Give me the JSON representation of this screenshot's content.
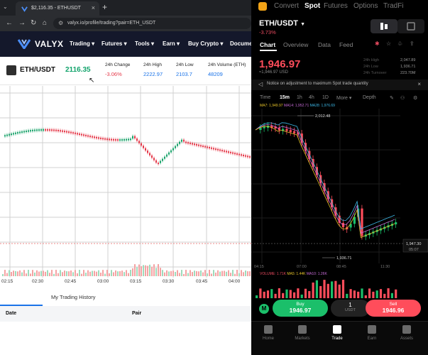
{
  "browser": {
    "tab_title": "$2,116.35 - ETHUSDT",
    "url": "valyx.io/profile/trading?pair=ETH_USDT"
  },
  "site": {
    "logo": "VALYX",
    "nav": [
      "Trading",
      "Futures",
      "Tools",
      "Earn",
      "Buy Crypto",
      "Docume"
    ]
  },
  "ticker": {
    "pair": "ETH/USDT",
    "price": "2116.35",
    "stats": [
      {
        "label": "24h Change",
        "value": "-3.06%",
        "color": "#e5394a"
      },
      {
        "label": "24h High",
        "value": "2222.97",
        "color": "#1a73e8"
      },
      {
        "label": "24h Low",
        "value": "2103.7",
        "color": "#1a73e8"
      },
      {
        "label": "24h Volume (ETH)",
        "value": "48209",
        "color": "#1a73e8"
      }
    ]
  },
  "left_chart": {
    "x_ticks": [
      "02:15",
      "02:30",
      "02:45",
      "03:00",
      "03:15",
      "03:30",
      "03:45",
      "04:00"
    ]
  },
  "history": {
    "tab": "My Trading History",
    "headers": [
      "Date",
      "Pair"
    ]
  },
  "app": {
    "top_nav": [
      "Convert",
      "Spot",
      "Futures",
      "Options",
      "TradFi"
    ],
    "active_nav": "Spot",
    "pair": "ETH/USDT",
    "change": "-3.73%",
    "sub_tabs": [
      "Chart",
      "Overview",
      "Data",
      "Feed"
    ],
    "price": "1,946.97",
    "price_sub": "≈1,946.97 USD",
    "right_stats": [
      {
        "label": "24h High",
        "value": "2,047.89"
      },
      {
        "label": "24h Low",
        "value": "1,936.71"
      },
      {
        "label": "24h Turnover",
        "value": "223.70M"
      }
    ],
    "notice": "Notice on adjustment to maximum Spot trade quantity",
    "timeframes": [
      "Time",
      "15m",
      "1h",
      "4h",
      "1D",
      "More",
      "Depth"
    ],
    "active_tf": "15m",
    "ma_row": [
      {
        "text": "MA7: 1,949.97",
        "color": "#e6c229"
      },
      {
        "text": "MA14: 1,952.71",
        "color": "#c66bd6"
      },
      {
        "text": "MA28: 1,976.69",
        "color": "#3cb7e6"
      }
    ],
    "price_labels": [
      "2,012.48",
      "1,947.30",
      "1,936.71"
    ],
    "countdown": "05:07",
    "time_labels": [
      "04:15",
      "07:00",
      "08:45",
      "11:30"
    ],
    "vol_row": [
      {
        "text": "VOLUME: 1.71K",
        "color": "#e84a5f"
      },
      {
        "text": "MA5: 1.44K",
        "color": "#e6c229"
      },
      {
        "text": "MA10: 1.26K",
        "color": "#c66bd6"
      }
    ],
    "buy_label": "Buy",
    "buy_price": "1946.97",
    "lots_top": "1",
    "lots_bottom": "USDT",
    "sell_label": "Sell",
    "sell_price": "1946.96",
    "bottom_nav": [
      "Home",
      "Markets",
      "Trade",
      "Earn",
      "Assets"
    ],
    "active_bottom": "Trade"
  }
}
